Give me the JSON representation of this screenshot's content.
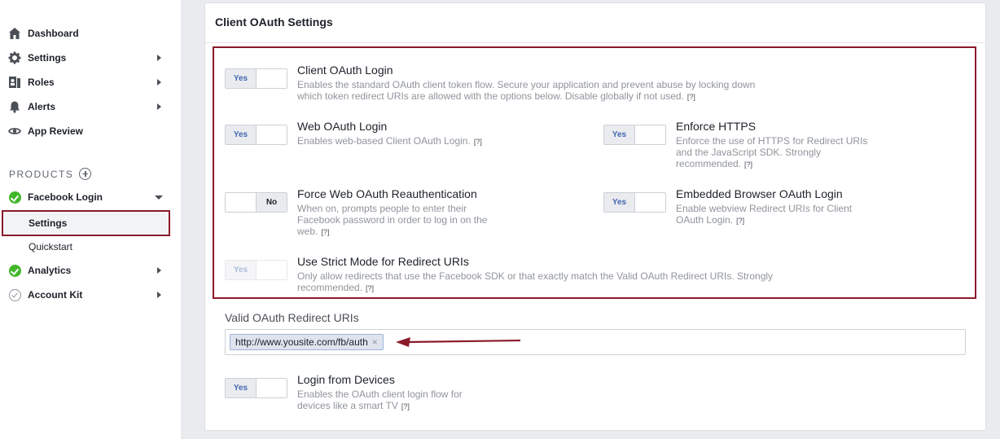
{
  "sidebar": {
    "items": [
      {
        "label": "Dashboard",
        "icon": "home-icon"
      },
      {
        "label": "Settings",
        "icon": "gear-icon"
      },
      {
        "label": "Roles",
        "icon": "roles-icon"
      },
      {
        "label": "Alerts",
        "icon": "bell-icon"
      },
      {
        "label": "App Review",
        "icon": "eye-icon"
      }
    ],
    "products_label": "PRODUCTS",
    "facebook_login": "Facebook Login",
    "sub_settings": "Settings",
    "sub_quickstart": "Quickstart",
    "analytics": "Analytics",
    "account_kit": "Account Kit"
  },
  "panel": {
    "title": "Client OAuth Settings"
  },
  "settings": {
    "client_oauth": {
      "title": "Client OAuth Login",
      "desc1": "Enables the standard OAuth client token flow. Secure your application and prevent abuse by locking down",
      "desc2": "which token redirect URIs are allowed with the options below. Disable globally if not used.",
      "toggle": "Yes"
    },
    "web_oauth": {
      "title": "Web OAuth Login",
      "desc1": "Enables web-based Client OAuth Login.",
      "toggle": "Yes"
    },
    "enforce_https": {
      "title": "Enforce HTTPS",
      "desc1": "Enforce the use of HTTPS for Redirect URIs",
      "desc2": "and the JavaScript SDK. Strongly",
      "desc3": "recommended.",
      "toggle": "Yes"
    },
    "force_reauth": {
      "title": "Force Web OAuth Reauthentication",
      "desc1": "When on, prompts people to enter their",
      "desc2": "Facebook password in order to log in on the",
      "desc3": "web.",
      "toggle": "No"
    },
    "embedded_browser": {
      "title": "Embedded Browser OAuth Login",
      "desc1": "Enable webview Redirect URIs for Client",
      "desc2": "OAuth Login.",
      "toggle": "Yes"
    },
    "strict_mode": {
      "title": "Use Strict Mode for Redirect URIs",
      "desc1": "Only allow redirects that use the Facebook SDK or that exactly match the Valid OAuth Redirect URIs. Strongly",
      "desc2": "recommended.",
      "toggle": "Yes"
    },
    "login_devices": {
      "title": "Login from Devices",
      "desc1": "Enables the OAuth client login flow for",
      "desc2": "devices like a smart TV",
      "toggle": "Yes"
    }
  },
  "help_marker": "[?]",
  "redirect_uris": {
    "label": "Valid OAuth Redirect URIs",
    "tag": "http://www.yousite.com/fb/auth",
    "remove": "×"
  },
  "colors": {
    "highlight": "#8b1a2b",
    "toggle_yes": "#4267b2",
    "check_green": "#42b72a"
  }
}
